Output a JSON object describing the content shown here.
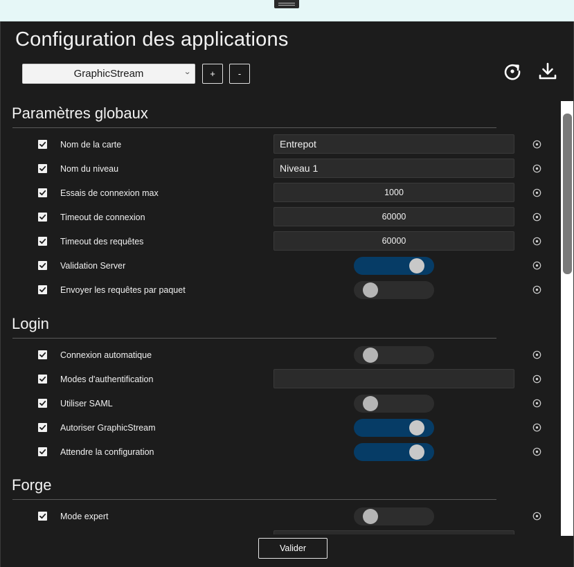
{
  "window": {
    "title": "Configuration des applications"
  },
  "toolbar": {
    "selected_app": "GraphicStream",
    "add_label": "+",
    "remove_label": "-",
    "refresh_icon": "refresh-icon",
    "download_icon": "download-icon"
  },
  "sections": [
    {
      "title": "Paramètres globaux",
      "rows": [
        {
          "label": "Nom de la carte",
          "checked": true,
          "type": "text",
          "value": "Entrepot"
        },
        {
          "label": "Nom du niveau",
          "checked": true,
          "type": "text",
          "value": "Niveau 1"
        },
        {
          "label": "Essais de connexion max",
          "checked": true,
          "type": "number",
          "value": "1000"
        },
        {
          "label": "Timeout de connexion",
          "checked": true,
          "type": "number",
          "value": "60000"
        },
        {
          "label": "Timeout des requêtes",
          "checked": true,
          "type": "number",
          "value": "60000"
        },
        {
          "label": "Validation Server",
          "checked": true,
          "type": "toggle",
          "on": true
        },
        {
          "label": "Envoyer les requêtes par paquet",
          "checked": true,
          "type": "toggle",
          "on": false
        }
      ]
    },
    {
      "title": "Login",
      "rows": [
        {
          "label": "Connexion automatique",
          "checked": true,
          "type": "toggle",
          "on": false
        },
        {
          "label": "Modes d'authentification",
          "checked": true,
          "type": "text",
          "value": ""
        },
        {
          "label": "Utiliser SAML",
          "checked": true,
          "type": "toggle",
          "on": false
        },
        {
          "label": "Autoriser GraphicStream",
          "checked": true,
          "type": "toggle",
          "on": true
        },
        {
          "label": "Attendre la configuration",
          "checked": true,
          "type": "toggle",
          "on": true
        }
      ]
    },
    {
      "title": "Forge",
      "rows": [
        {
          "label": "Mode expert",
          "checked": true,
          "type": "toggle",
          "on": false
        }
      ]
    }
  ],
  "footer": {
    "validate_label": "Valider"
  }
}
